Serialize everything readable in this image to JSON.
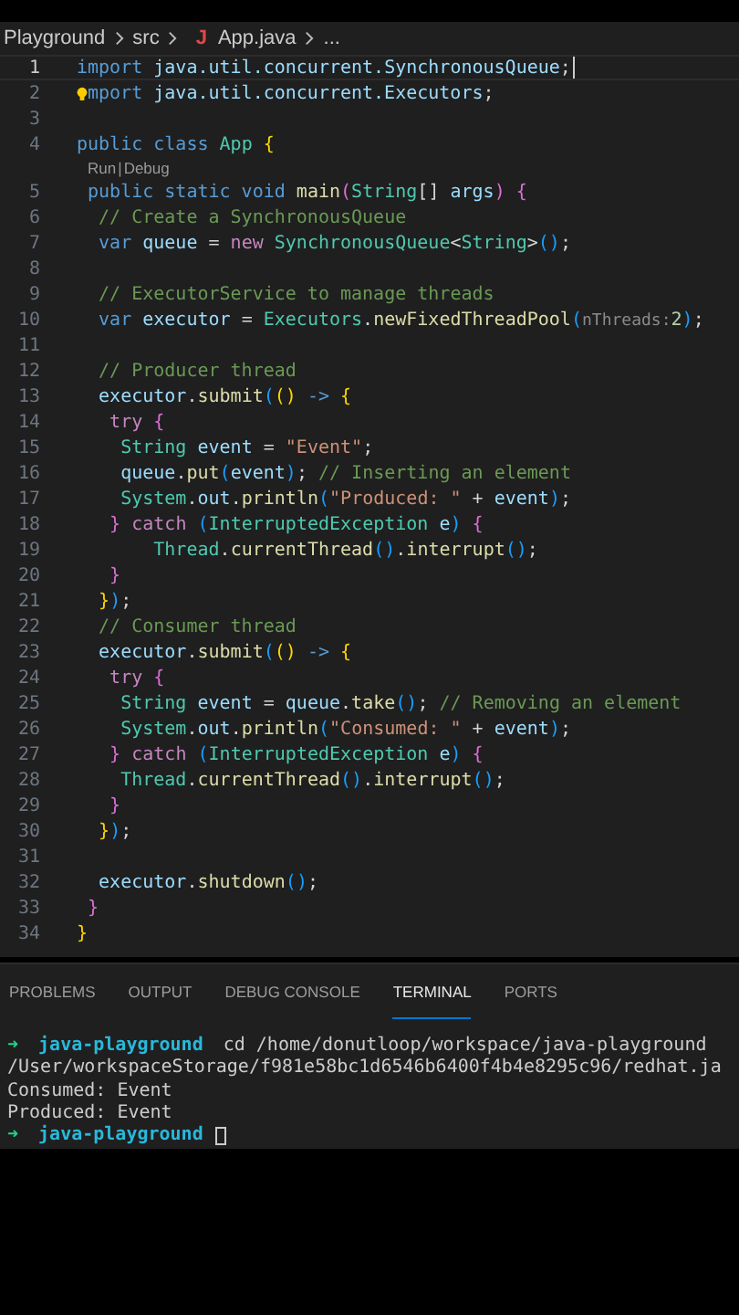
{
  "breadcrumb": {
    "items": [
      {
        "label": "Playground",
        "kind": "folder"
      },
      {
        "label": "src",
        "kind": "folder"
      },
      {
        "label": "App.java",
        "kind": "file",
        "icon": "J"
      },
      {
        "label": "...",
        "kind": "more"
      }
    ]
  },
  "editor": {
    "lines": [
      {
        "kind": "code",
        "number": "1",
        "active": true,
        "tokens": [
          {
            "text": "import",
            "kind": "kw"
          },
          {
            "text": " java.util.concurrent.SynchronousQueue",
            "kind": "ns"
          },
          {
            "text": ";",
            "kind": "p"
          }
        ]
      },
      {
        "kind": "code",
        "number": "2",
        "active": false,
        "lightbulb": true,
        "tokens": [
          {
            "text": "mport",
            "kind": "kw"
          },
          {
            "text": " java.util.concurrent.Executors",
            "kind": "ns"
          },
          {
            "text": ";",
            "kind": "p"
          }
        ]
      },
      {
        "kind": "code",
        "number": "3",
        "active": false
      },
      {
        "kind": "code",
        "number": "4",
        "active": false,
        "tokens": [
          {
            "text": "public class ",
            "kind": "kw"
          },
          {
            "text": "App",
            "kind": "type"
          },
          {
            "text": " {",
            "kind": "b1"
          }
        ]
      },
      {
        "kind": "codelens",
        "links": [
          "Run",
          "Debug"
        ],
        "separator": "|"
      },
      {
        "kind": "code",
        "number": "5",
        "active": false,
        "tokens": [
          {
            "text": " public static void ",
            "kind": "kw"
          },
          {
            "text": "main",
            "kind": "fn"
          },
          {
            "text": "(",
            "kind": "b2"
          },
          {
            "text": "String",
            "kind": "type"
          },
          {
            "text": "[]",
            "kind": "p"
          },
          {
            "text": " args",
            "kind": "var"
          },
          {
            "text": ") {",
            "kind": "b2"
          }
        ]
      },
      {
        "kind": "code",
        "number": "6",
        "active": false,
        "tokens": [
          {
            "text": "  // Create a SynchronousQueue",
            "kind": "com"
          }
        ]
      },
      {
        "kind": "code",
        "number": "7",
        "active": false,
        "tokens": [
          {
            "text": "  var ",
            "kind": "kw"
          },
          {
            "text": "queue",
            "kind": "var"
          },
          {
            "text": " = ",
            "kind": "p"
          },
          {
            "text": "new ",
            "kind": "ctrl"
          },
          {
            "text": "SynchronousQueue",
            "kind": "type"
          },
          {
            "text": "<",
            "kind": "p"
          },
          {
            "text": "String",
            "kind": "type"
          },
          {
            "text": ">",
            "kind": "p"
          },
          {
            "text": "()",
            "kind": "b3"
          },
          {
            "text": ";",
            "kind": "p"
          }
        ]
      },
      {
        "kind": "code",
        "number": "8",
        "active": false
      },
      {
        "kind": "code",
        "number": "9",
        "active": false,
        "tokens": [
          {
            "text": "  // ExecutorService to manage threads",
            "kind": "com"
          }
        ]
      },
      {
        "kind": "code",
        "number": "10",
        "active": false,
        "tokens": [
          {
            "text": "  var ",
            "kind": "kw"
          },
          {
            "text": "executor",
            "kind": "var"
          },
          {
            "text": " = ",
            "kind": "p"
          },
          {
            "text": "Executors",
            "kind": "type"
          },
          {
            "text": ".",
            "kind": "p"
          },
          {
            "text": "newFixedThreadPool",
            "kind": "fn"
          },
          {
            "text": "(",
            "kind": "b3"
          },
          {
            "text": "nThreads:",
            "kind": "hint"
          },
          {
            "text": "2",
            "kind": "num"
          },
          {
            "text": ")",
            "kind": "b3"
          },
          {
            "text": ";",
            "kind": "p"
          }
        ]
      },
      {
        "kind": "code",
        "number": "11",
        "active": false
      },
      {
        "kind": "code",
        "number": "12",
        "active": false,
        "tokens": [
          {
            "text": "  // Producer thread",
            "kind": "com"
          }
        ]
      },
      {
        "kind": "code",
        "number": "13",
        "active": false,
        "tokens": [
          {
            "text": "  executor",
            "kind": "var"
          },
          {
            "text": ".",
            "kind": "p"
          },
          {
            "text": "submit",
            "kind": "fn"
          },
          {
            "text": "(",
            "kind": "b3"
          },
          {
            "text": "()",
            "kind": "b1"
          },
          {
            "text": " -> ",
            "kind": "kw"
          },
          {
            "text": "{",
            "kind": "b1"
          }
        ]
      },
      {
        "kind": "code",
        "number": "14",
        "active": false,
        "tokens": [
          {
            "text": "   try ",
            "kind": "ctrl"
          },
          {
            "text": "{",
            "kind": "b2"
          }
        ]
      },
      {
        "kind": "code",
        "number": "15",
        "active": false,
        "tokens": [
          {
            "text": "    String",
            "kind": "type"
          },
          {
            "text": " event",
            "kind": "var"
          },
          {
            "text": " = ",
            "kind": "p"
          },
          {
            "text": "\"Event\"",
            "kind": "str"
          },
          {
            "text": ";",
            "kind": "p"
          }
        ]
      },
      {
        "kind": "code",
        "number": "16",
        "active": false,
        "tokens": [
          {
            "text": "    queue",
            "kind": "var"
          },
          {
            "text": ".",
            "kind": "p"
          },
          {
            "text": "put",
            "kind": "fn"
          },
          {
            "text": "(",
            "kind": "b3"
          },
          {
            "text": "event",
            "kind": "var"
          },
          {
            "text": ")",
            "kind": "b3"
          },
          {
            "text": "; ",
            "kind": "p"
          },
          {
            "text": "// Inserting an element",
            "kind": "com"
          }
        ]
      },
      {
        "kind": "code",
        "number": "17",
        "active": false,
        "tokens": [
          {
            "text": "    System",
            "kind": "type"
          },
          {
            "text": ".",
            "kind": "p"
          },
          {
            "text": "out",
            "kind": "var"
          },
          {
            "text": ".",
            "kind": "p"
          },
          {
            "text": "println",
            "kind": "fn"
          },
          {
            "text": "(",
            "kind": "b3"
          },
          {
            "text": "\"Produced: \"",
            "kind": "str"
          },
          {
            "text": " + ",
            "kind": "p"
          },
          {
            "text": "event",
            "kind": "var"
          },
          {
            "text": ")",
            "kind": "b3"
          },
          {
            "text": ";",
            "kind": "p"
          }
        ]
      },
      {
        "kind": "code",
        "number": "18",
        "active": false,
        "tokens": [
          {
            "text": "   }",
            "kind": "b2"
          },
          {
            "text": " catch ",
            "kind": "ctrl"
          },
          {
            "text": "(",
            "kind": "b3"
          },
          {
            "text": "InterruptedException",
            "kind": "type"
          },
          {
            "text": " e",
            "kind": "var"
          },
          {
            "text": ")",
            "kind": "b3"
          },
          {
            "text": " {",
            "kind": "b2"
          }
        ]
      },
      {
        "kind": "code",
        "number": "19",
        "active": false,
        "tokens": [
          {
            "text": "       Thread",
            "kind": "type"
          },
          {
            "text": ".",
            "kind": "p"
          },
          {
            "text": "currentThread",
            "kind": "fn"
          },
          {
            "text": "()",
            "kind": "b3"
          },
          {
            "text": ".",
            "kind": "p"
          },
          {
            "text": "interrupt",
            "kind": "fn"
          },
          {
            "text": "()",
            "kind": "b3"
          },
          {
            "text": ";",
            "kind": "p"
          }
        ]
      },
      {
        "kind": "code",
        "number": "20",
        "active": false,
        "tokens": [
          {
            "text": "   }",
            "kind": "b2"
          }
        ]
      },
      {
        "kind": "code",
        "number": "21",
        "active": false,
        "tokens": [
          {
            "text": "  }",
            "kind": "b1"
          },
          {
            "text": ")",
            "kind": "b3"
          },
          {
            "text": ";",
            "kind": "p"
          }
        ]
      },
      {
        "kind": "code",
        "number": "22",
        "active": false,
        "tokens": [
          {
            "text": "  // Consumer thread",
            "kind": "com"
          }
        ]
      },
      {
        "kind": "code",
        "number": "23",
        "active": false,
        "tokens": [
          {
            "text": "  executor",
            "kind": "var"
          },
          {
            "text": ".",
            "kind": "p"
          },
          {
            "text": "submit",
            "kind": "fn"
          },
          {
            "text": "(",
            "kind": "b3"
          },
          {
            "text": "()",
            "kind": "b1"
          },
          {
            "text": " -> ",
            "kind": "kw"
          },
          {
            "text": "{",
            "kind": "b1"
          }
        ]
      },
      {
        "kind": "code",
        "number": "24",
        "active": false,
        "tokens": [
          {
            "text": "   try ",
            "kind": "ctrl"
          },
          {
            "text": "{",
            "kind": "b2"
          }
        ]
      },
      {
        "kind": "code",
        "number": "25",
        "active": false,
        "tokens": [
          {
            "text": "    String",
            "kind": "type"
          },
          {
            "text": " event",
            "kind": "var"
          },
          {
            "text": " = ",
            "kind": "p"
          },
          {
            "text": "queue",
            "kind": "var"
          },
          {
            "text": ".",
            "kind": "p"
          },
          {
            "text": "take",
            "kind": "fn"
          },
          {
            "text": "()",
            "kind": "b3"
          },
          {
            "text": "; ",
            "kind": "p"
          },
          {
            "text": "// Removing an element",
            "kind": "com"
          }
        ]
      },
      {
        "kind": "code",
        "number": "26",
        "active": false,
        "tokens": [
          {
            "text": "    System",
            "kind": "type"
          },
          {
            "text": ".",
            "kind": "p"
          },
          {
            "text": "out",
            "kind": "var"
          },
          {
            "text": ".",
            "kind": "p"
          },
          {
            "text": "println",
            "kind": "fn"
          },
          {
            "text": "(",
            "kind": "b3"
          },
          {
            "text": "\"Consumed: \"",
            "kind": "str"
          },
          {
            "text": " + ",
            "kind": "p"
          },
          {
            "text": "event",
            "kind": "var"
          },
          {
            "text": ")",
            "kind": "b3"
          },
          {
            "text": ";",
            "kind": "p"
          }
        ]
      },
      {
        "kind": "code",
        "number": "27",
        "active": false,
        "tokens": [
          {
            "text": "   }",
            "kind": "b2"
          },
          {
            "text": " catch ",
            "kind": "ctrl"
          },
          {
            "text": "(",
            "kind": "b3"
          },
          {
            "text": "InterruptedException",
            "kind": "type"
          },
          {
            "text": " e",
            "kind": "var"
          },
          {
            "text": ")",
            "kind": "b3"
          },
          {
            "text": " {",
            "kind": "b2"
          }
        ]
      },
      {
        "kind": "code",
        "number": "28",
        "active": false,
        "tokens": [
          {
            "text": "    Thread",
            "kind": "type"
          },
          {
            "text": ".",
            "kind": "p"
          },
          {
            "text": "currentThread",
            "kind": "fn"
          },
          {
            "text": "()",
            "kind": "b3"
          },
          {
            "text": ".",
            "kind": "p"
          },
          {
            "text": "interrupt",
            "kind": "fn"
          },
          {
            "text": "()",
            "kind": "b3"
          },
          {
            "text": ";",
            "kind": "p"
          }
        ]
      },
      {
        "kind": "code",
        "number": "29",
        "active": false,
        "tokens": [
          {
            "text": "   }",
            "kind": "b2"
          }
        ]
      },
      {
        "kind": "code",
        "number": "30",
        "active": false,
        "tokens": [
          {
            "text": "  }",
            "kind": "b1"
          },
          {
            "text": ")",
            "kind": "b3"
          },
          {
            "text": ";",
            "kind": "p"
          }
        ]
      },
      {
        "kind": "code",
        "number": "31",
        "active": false
      },
      {
        "kind": "code",
        "number": "32",
        "active": false,
        "tokens": [
          {
            "text": "  executor",
            "kind": "var"
          },
          {
            "text": ".",
            "kind": "p"
          },
          {
            "text": "shutdown",
            "kind": "fn"
          },
          {
            "text": "()",
            "kind": "b3"
          },
          {
            "text": ";",
            "kind": "p"
          }
        ]
      },
      {
        "kind": "code",
        "number": "33",
        "active": false,
        "tokens": [
          {
            "text": " }",
            "kind": "b2"
          }
        ]
      },
      {
        "kind": "code",
        "number": "34",
        "active": false,
        "tokens": [
          {
            "text": "}",
            "kind": "b1"
          }
        ]
      }
    ]
  },
  "panel": {
    "tabs": [
      {
        "label": "PROBLEMS",
        "selected": false
      },
      {
        "label": "OUTPUT",
        "selected": false
      },
      {
        "label": "DEBUG CONSOLE",
        "selected": false
      },
      {
        "label": "TERMINAL",
        "selected": true
      },
      {
        "label": "PORTS",
        "selected": false
      }
    ],
    "terminal": [
      {
        "kind": "prompt",
        "arrow": "➜",
        "directory": "java-playground",
        "command": "cd /home/donutloop/workspace/java-playground",
        "cursor": false
      },
      {
        "kind": "output",
        "text": "/User/workspaceStorage/f981e58bc1d6546b6400f4b4e8295c96/redhat.ja"
      },
      {
        "kind": "output",
        "text": "Consumed: Event"
      },
      {
        "kind": "output",
        "text": "Produced: Event"
      },
      {
        "kind": "prompt",
        "arrow": "➜",
        "directory": "java-playground",
        "cursor": true
      }
    ]
  }
}
